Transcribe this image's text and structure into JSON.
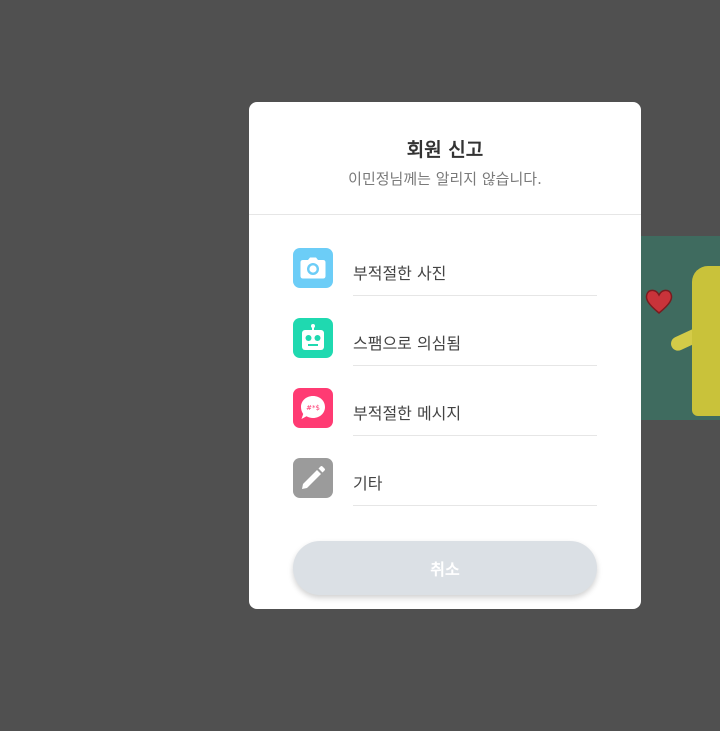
{
  "modal": {
    "title": "회원 신고",
    "subtitle": "이민정님께는 알리지 않습니다."
  },
  "options": [
    {
      "label": "부적절한 사진",
      "icon": "camera-icon",
      "color": "#6ccdf7"
    },
    {
      "label": "스팸으로 의심됨",
      "icon": "robot-icon",
      "color": "#1fd9b0"
    },
    {
      "label": "부적절한 메시지",
      "icon": "chat-bubble-icon",
      "color": "#ff3b73"
    },
    {
      "label": "기타",
      "icon": "pencil-icon",
      "color": "#9b9b9b"
    }
  ],
  "chat_icon_glyph": "#*$",
  "cancel_label": "취소",
  "colors": {
    "overlay": "#505050",
    "cancel_bg": "#dbe0e5"
  }
}
